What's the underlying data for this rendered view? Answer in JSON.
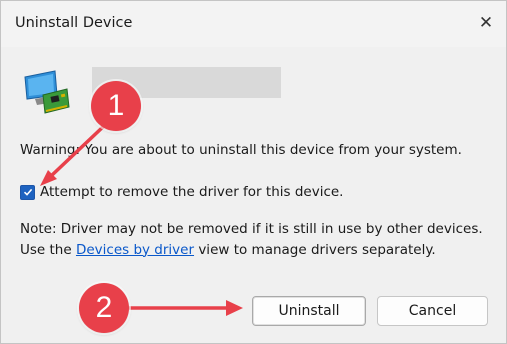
{
  "window": {
    "title": "Uninstall Device",
    "close_icon": "close-icon"
  },
  "device": {
    "icon": "network-adapter-icon",
    "name_redacted": true
  },
  "warning_text": "Warning: You are about to uninstall this device from your system.",
  "checkbox": {
    "label": "Attempt to remove the driver for this device.",
    "checked": true
  },
  "note": {
    "before_link": "Note: Driver may not be removed if it is still in use by other devices. Use the ",
    "link_text": "Devices by driver",
    "after_link": " view to manage drivers separately."
  },
  "buttons": {
    "uninstall": "Uninstall",
    "cancel": "Cancel"
  },
  "annotations": [
    {
      "label": "1",
      "color": "#e8404a"
    },
    {
      "label": "2",
      "color": "#e8404a"
    }
  ],
  "colors": {
    "accent": "#1d62c0",
    "link": "#0a58ca",
    "annotation": "#e8404a"
  }
}
